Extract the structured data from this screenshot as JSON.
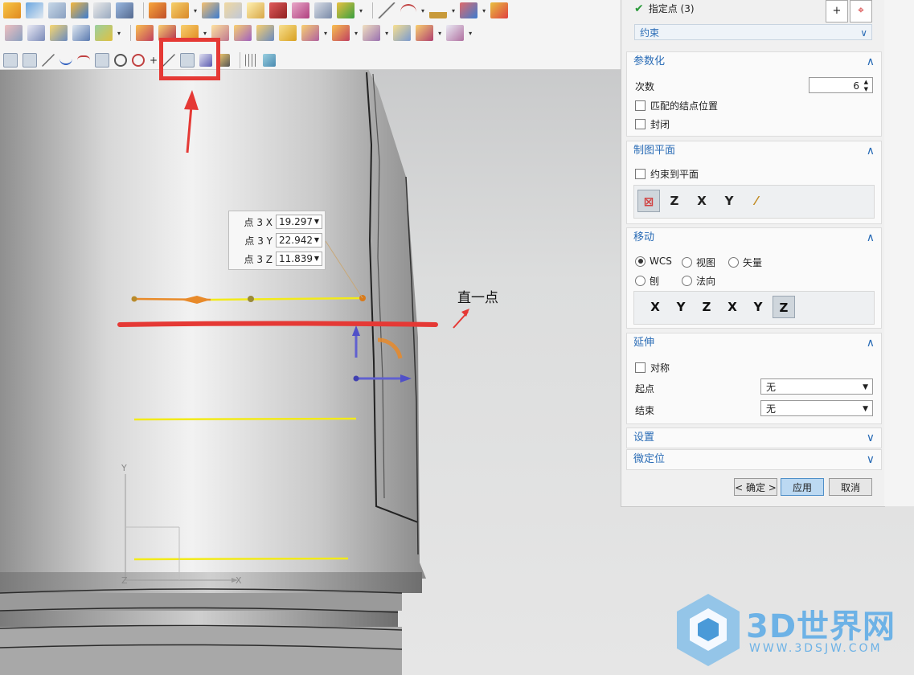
{
  "panel": {
    "specify_point": {
      "label": "指定点 (3)",
      "check": "✔"
    },
    "constraint_select": {
      "value": "约束"
    },
    "parameterization": {
      "title": "参数化",
      "degree_label": "次数",
      "degree_value": "6",
      "match_knots_label": "匹配的结点位置",
      "closed_label": "封闭"
    },
    "drawing_plane": {
      "title": "制图平面",
      "constrain_to_plane_label": "约束到平面"
    },
    "move": {
      "title": "移动",
      "options": [
        "WCS",
        "视图",
        "矢量",
        "刨",
        "法向"
      ],
      "selected": "WCS"
    },
    "extension": {
      "title": "延伸",
      "symmetric_label": "对称",
      "start_label": "起点",
      "start_value": "无",
      "end_label": "结束",
      "end_value": "无"
    },
    "settings": {
      "title": "设置"
    },
    "micro_position": {
      "title": "微定位"
    },
    "buttons": {
      "ok": "< 确定 >",
      "apply": "应用",
      "cancel": "取消"
    }
  },
  "coord_popup": {
    "rows": [
      {
        "label": "点 3 X",
        "value": "19.297"
      },
      {
        "label": "点 3 Y",
        "value": "22.942"
      },
      {
        "label": "点 3 Z",
        "value": "11.839"
      }
    ]
  },
  "annotation": {
    "text": "直一点"
  },
  "axis": {
    "x": "X",
    "y": "Y",
    "z": "Z"
  },
  "watermark": {
    "brand": "3D世界网",
    "url": "WWW.3DSJW.COM"
  },
  "colors": {
    "accent": "#2a6cb6",
    "highlight_box": "#e53935",
    "yellow_line": "#f2ea1a",
    "orange_line": "#e88a2a"
  }
}
